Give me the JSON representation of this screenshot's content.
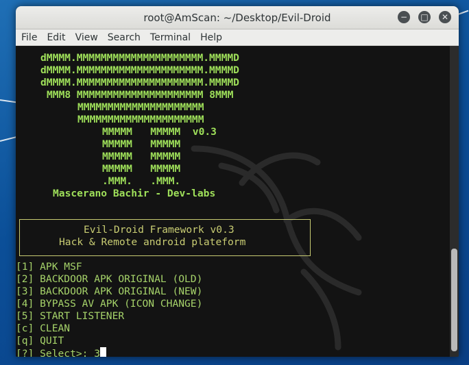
{
  "window": {
    "title": "root@AmScan: ~/Desktop/Evil-Droid",
    "controls": [
      "minimize-icon",
      "maximize-icon",
      "close-icon"
    ]
  },
  "menubar": [
    "File",
    "Edit",
    "View",
    "Search",
    "Terminal",
    "Help"
  ],
  "terminal": {
    "logo_lines": [
      "dMMMM.MMMMMMMMMMMMMMMMMMMMM.MMMMD",
      "dMMMM.MMMMMMMMMMMMMMMMMMMMM.MMMMD",
      "dMMMM.MMMMMMMMMMMMMMMMMMMMM.MMMMD",
      "MMM8 MMMMMMMMMMMMMMMMMMMMM 8MMM",
      "MMMMMMMMMMMMMMMMMMMMM",
      "MMMMMMMMMMMMMMMMMMMMM",
      "MMMMM   MMMMM  v0.3",
      "MMMMM   MMMMM",
      "MMMMM   MMMMM",
      "MMMMM   MMMMM",
      ".MMM.   .MMM.",
      "Mascerano Bachir - Dev-labs"
    ],
    "box_lines": [
      "Evil-Droid Framework v0.3",
      "Hack & Remote android plateform"
    ],
    "menu_options": [
      "[1] APK MSF",
      "[2] BACKDOOR APK ORIGINAL (OLD)",
      "[3] BACKDOOR APK ORIGINAL (NEW)",
      "[4] BYPASS AV APK (ICON CHANGE)",
      "[5] START LISTENER",
      "[c] CLEAN",
      "[q] QUIT"
    ],
    "prompt": "[?] Select>: ",
    "input_value": "3"
  },
  "colors": {
    "terminal_bg": "#131313",
    "logo_green": "#9fe05a",
    "menu_green": "#a6d36a",
    "box_yellow": "#c9cd73"
  }
}
